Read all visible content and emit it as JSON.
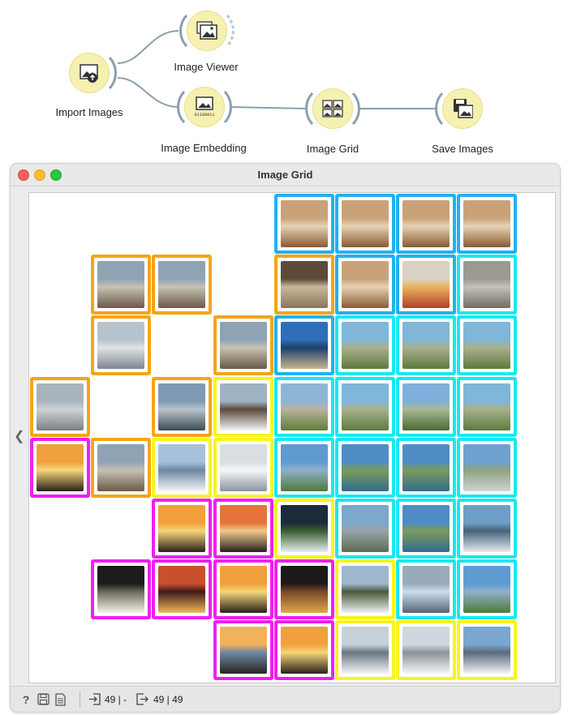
{
  "workflow": {
    "nodes": [
      {
        "id": "import",
        "label": "Import Images",
        "icon": "import-images-icon"
      },
      {
        "id": "viewer",
        "label": "Image Viewer",
        "icon": "image-viewer-icon"
      },
      {
        "id": "embedding",
        "label": "Image Embedding",
        "icon": "image-embedding-icon"
      },
      {
        "id": "grid",
        "label": "Image Grid",
        "icon": "image-grid-icon"
      },
      {
        "id": "save",
        "label": "Save Images",
        "icon": "save-images-icon"
      }
    ],
    "embedding_icon_text": "01100011"
  },
  "window": {
    "title": "Image Grid",
    "colors": {
      "close": "#fe5f57",
      "minimize": "#febc2e",
      "maximize": "#28c840"
    }
  },
  "grid": {
    "cluster_colors": {
      "blue": "#1fb2f0",
      "cyan": "#18e8f0",
      "orange": "#f5a516",
      "yellow": "#f7f51c",
      "magenta": "#f01ff0"
    },
    "images": [
      {
        "row": 0,
        "col": 4,
        "cluster": "blue",
        "subject": "bread"
      },
      {
        "row": 0,
        "col": 5,
        "cluster": "blue",
        "subject": "bread"
      },
      {
        "row": 0,
        "col": 6,
        "cluster": "blue",
        "subject": "bread"
      },
      {
        "row": 0,
        "col": 7,
        "cluster": "blue",
        "subject": "bread"
      },
      {
        "row": 1,
        "col": 1,
        "cluster": "orange",
        "subject": "street"
      },
      {
        "row": 1,
        "col": 2,
        "cluster": "orange",
        "subject": "street"
      },
      {
        "row": 1,
        "col": 4,
        "cluster": "orange",
        "subject": "alley"
      },
      {
        "row": 1,
        "col": 5,
        "cluster": "blue",
        "subject": "bread"
      },
      {
        "row": 1,
        "col": 6,
        "cluster": "blue",
        "subject": "pizza"
      },
      {
        "row": 1,
        "col": 7,
        "cluster": "cyan",
        "subject": "rock"
      },
      {
        "row": 2,
        "col": 1,
        "cluster": "orange",
        "subject": "bus lane"
      },
      {
        "row": 2,
        "col": 3,
        "cluster": "orange",
        "subject": "street"
      },
      {
        "row": 2,
        "col": 4,
        "cluster": "blue",
        "subject": "church"
      },
      {
        "row": 2,
        "col": 5,
        "cluster": "cyan",
        "subject": "mountain"
      },
      {
        "row": 2,
        "col": 6,
        "cluster": "cyan",
        "subject": "mountain"
      },
      {
        "row": 2,
        "col": 7,
        "cluster": "cyan",
        "subject": "mountain"
      },
      {
        "row": 3,
        "col": 0,
        "cluster": "orange",
        "subject": "square"
      },
      {
        "row": 3,
        "col": 2,
        "cluster": "orange",
        "subject": "city"
      },
      {
        "row": 3,
        "col": 3,
        "cluster": "yellow",
        "subject": "snow hut"
      },
      {
        "row": 3,
        "col": 4,
        "cluster": "cyan",
        "subject": "trail"
      },
      {
        "row": 3,
        "col": 5,
        "cluster": "cyan",
        "subject": "mountain"
      },
      {
        "row": 3,
        "col": 6,
        "cluster": "cyan",
        "subject": "hikers"
      },
      {
        "row": 3,
        "col": 7,
        "cluster": "cyan",
        "subject": "mountain"
      },
      {
        "row": 4,
        "col": 0,
        "cluster": "magenta",
        "subject": "sunset"
      },
      {
        "row": 4,
        "col": 1,
        "cluster": "orange",
        "subject": "street"
      },
      {
        "row": 4,
        "col": 2,
        "cluster": "yellow",
        "subject": "snow field"
      },
      {
        "row": 4,
        "col": 3,
        "cluster": "yellow",
        "subject": "snow trees"
      },
      {
        "row": 4,
        "col": 4,
        "cluster": "cyan",
        "subject": "ridge"
      },
      {
        "row": 4,
        "col": 5,
        "cluster": "cyan",
        "subject": "lake"
      },
      {
        "row": 4,
        "col": 6,
        "cluster": "cyan",
        "subject": "lake"
      },
      {
        "row": 4,
        "col": 7,
        "cluster": "cyan",
        "subject": "peak"
      },
      {
        "row": 5,
        "col": 2,
        "cluster": "magenta",
        "subject": "sunset"
      },
      {
        "row": 5,
        "col": 3,
        "cluster": "magenta",
        "subject": "sunset snow"
      },
      {
        "row": 5,
        "col": 4,
        "cluster": "yellow",
        "subject": "snow forest"
      },
      {
        "row": 5,
        "col": 5,
        "cluster": "cyan",
        "subject": "road"
      },
      {
        "row": 5,
        "col": 6,
        "cluster": "cyan",
        "subject": "lake"
      },
      {
        "row": 5,
        "col": 7,
        "cluster": "cyan",
        "subject": "clouds"
      },
      {
        "row": 6,
        "col": 1,
        "cluster": "magenta",
        "subject": "sun glare"
      },
      {
        "row": 6,
        "col": 2,
        "cluster": "magenta",
        "subject": "tent"
      },
      {
        "row": 6,
        "col": 3,
        "cluster": "magenta",
        "subject": "sunset"
      },
      {
        "row": 6,
        "col": 4,
        "cluster": "magenta",
        "subject": "sun rays"
      },
      {
        "row": 6,
        "col": 5,
        "cluster": "yellow",
        "subject": "snow road"
      },
      {
        "row": 6,
        "col": 6,
        "cluster": "cyan",
        "subject": "meadow"
      },
      {
        "row": 6,
        "col": 7,
        "cluster": "cyan",
        "subject": "ridge"
      },
      {
        "row": 7,
        "col": 3,
        "cluster": "magenta",
        "subject": "sunset grass"
      },
      {
        "row": 7,
        "col": 4,
        "cluster": "magenta",
        "subject": "sunset"
      },
      {
        "row": 7,
        "col": 5,
        "cluster": "yellow",
        "subject": "snow woods"
      },
      {
        "row": 7,
        "col": 6,
        "cluster": "yellow",
        "subject": "snow path"
      },
      {
        "row": 7,
        "col": 7,
        "cluster": "yellow",
        "subject": "ski slope"
      }
    ]
  },
  "statusbar": {
    "help_icon": "help-icon",
    "save_icon": "save-icon",
    "report_icon": "report-icon",
    "input_label": "49 | -",
    "output_label": "49 | 49"
  }
}
